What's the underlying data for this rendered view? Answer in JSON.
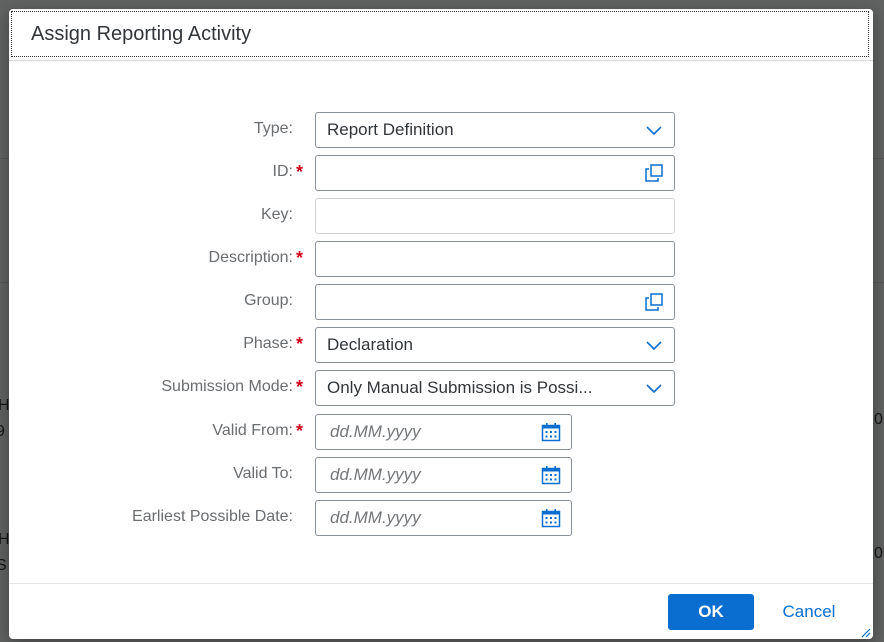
{
  "background": {
    "peek_left": [
      "H",
      "9",
      "H",
      "S"
    ],
    "peek_right": [
      "0",
      "0"
    ]
  },
  "dialog": {
    "title": "Assign Reporting Activity",
    "fields": {
      "type": {
        "label": "Type:",
        "value": "Report Definition",
        "icon": "chevron-down-icon"
      },
      "id": {
        "label": "ID:",
        "value": "",
        "required": true,
        "icon": "value-help-icon"
      },
      "key": {
        "label": "Key:",
        "value": "",
        "readonly": true
      },
      "description": {
        "label": "Description:",
        "value": "",
        "required": true
      },
      "group": {
        "label": "Group:",
        "value": "",
        "icon": "value-help-icon"
      },
      "phase": {
        "label": "Phase:",
        "value": "Declaration",
        "required": true,
        "icon": "chevron-down-icon"
      },
      "submission_mode": {
        "label": "Submission Mode:",
        "value": "Only Manual Submission is Possi...",
        "required": true,
        "icon": "chevron-down-icon"
      },
      "valid_from": {
        "label": "Valid From:",
        "placeholder": "dd.MM.yyyy",
        "required": true,
        "icon": "calendar-icon"
      },
      "valid_to": {
        "label": "Valid To:",
        "placeholder": "dd.MM.yyyy",
        "icon": "calendar-icon"
      },
      "earliest_possible_date": {
        "label": "Earliest Possible Date:",
        "placeholder": "dd.MM.yyyy",
        "icon": "calendar-icon"
      }
    },
    "required_marker": "*",
    "footer": {
      "ok_label": "OK",
      "cancel_label": "Cancel"
    }
  },
  "colors": {
    "accent": "#0a6ed1",
    "required": "#d0021b",
    "label": "#6a6d70",
    "text": "#32363a"
  }
}
